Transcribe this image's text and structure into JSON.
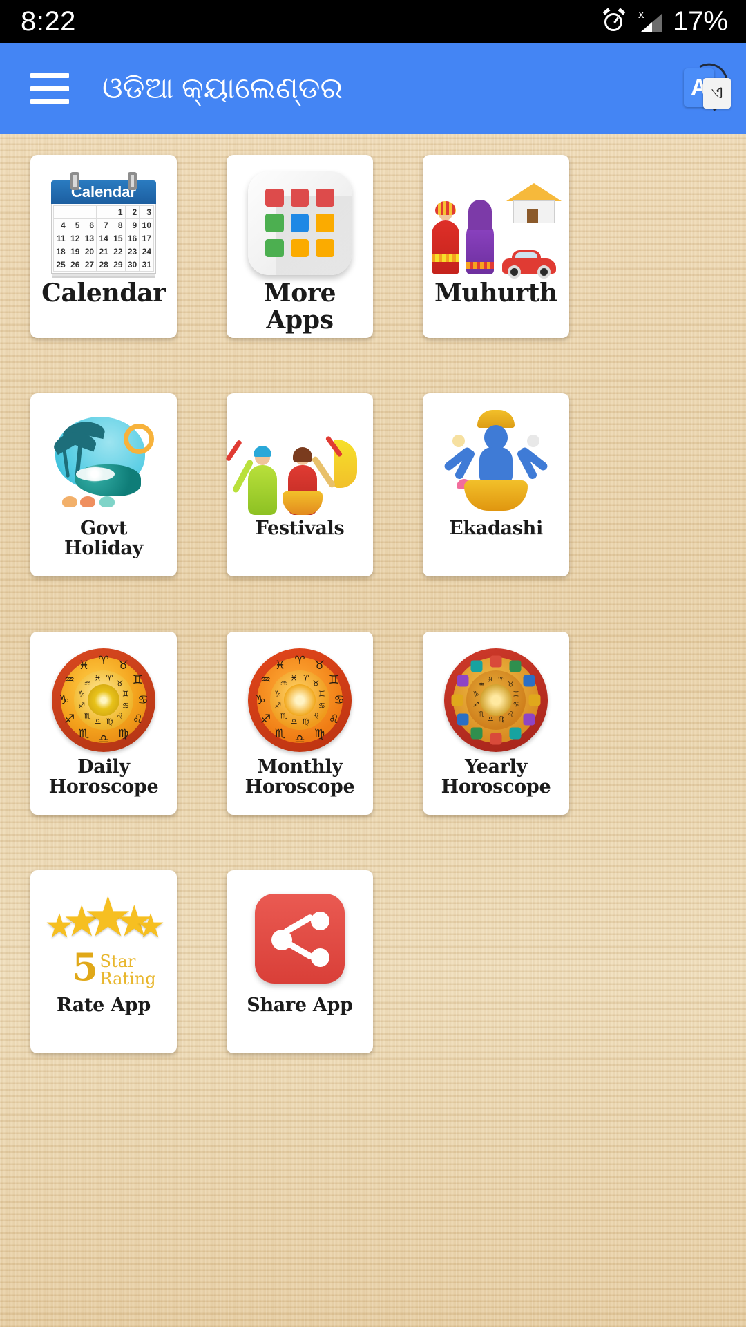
{
  "status_bar": {
    "time": "8:22",
    "battery": "17%",
    "alarm_icon": "alarm-clock-icon",
    "signal_icon": "signal-bars-icon",
    "signal_badge": "x"
  },
  "app_bar": {
    "menu_icon": "hamburger-menu-icon",
    "title": "ଓଡିଆ କ୍ୟାଲେଣ୍ଡର",
    "translate_icon": "translate-icon",
    "translate_source_letter": "A",
    "translate_target_letter": "ଏ",
    "background_color": "#4485f4"
  },
  "calendar_art": {
    "header": "Calendar",
    "weeks": [
      [
        "",
        "",
        "",
        "",
        "1",
        "2",
        "3"
      ],
      [
        "4",
        "5",
        "6",
        "7",
        "8",
        "9",
        "10"
      ],
      [
        "11",
        "12",
        "13",
        "14",
        "15",
        "16",
        "17"
      ],
      [
        "18",
        "19",
        "20",
        "21",
        "22",
        "23",
        "24"
      ],
      [
        "25",
        "26",
        "27",
        "28",
        "29",
        "30",
        "31"
      ]
    ]
  },
  "more_apps_art": {
    "swatches": [
      "#dd4b4b",
      "#dd4b4b",
      "#dd4b4b",
      "#4caf50",
      "#1e88e5",
      "#fbab00",
      "#4caf50",
      "#fbab00",
      "#fbab00"
    ]
  },
  "rate_art": {
    "number": "5",
    "word_top": "Star",
    "word_bottom": "Rating",
    "star_glyph": "★"
  },
  "zodiac_symbols": [
    "♈",
    "♉",
    "♊",
    "♋",
    "♌",
    "♍",
    "♎",
    "♏",
    "♐",
    "♑",
    "♒",
    "♓"
  ],
  "gem_colors": [
    "#d94a3a",
    "#2f8f4e",
    "#2b6fc4",
    "#e0a81c",
    "#8e44c4",
    "#17a3a0",
    "#d94a3a",
    "#2f8f4e",
    "#2b6fc4",
    "#e0a81c",
    "#8e44c4",
    "#17a3a0"
  ],
  "grid": {
    "rows": [
      [
        {
          "label": "Calendar",
          "label_lines": [
            "Calendar"
          ],
          "icon": "calendar-icon",
          "size": "big"
        },
        {
          "label": "More Apps",
          "label_lines": [
            "More Apps"
          ],
          "icon": "more-apps-grid-icon",
          "size": "big"
        },
        {
          "label": "Muhurth",
          "label_lines": [
            "Muhurth"
          ],
          "icon": "wedding-couple-icon",
          "size": "big"
        }
      ],
      [
        {
          "label": "Govt Holiday",
          "label_lines": [
            "Govt",
            "Holiday"
          ],
          "icon": "beach-holiday-icon",
          "size": "two"
        },
        {
          "label": "Festivals",
          "label_lines": [
            "Festivals"
          ],
          "icon": "folk-dancers-icon",
          "size": "mid"
        },
        {
          "label": "Ekadashi",
          "label_lines": [
            "Ekadashi"
          ],
          "icon": "vishnu-deity-icon",
          "size": "mid"
        }
      ],
      [
        {
          "label": "Daily Horoscope",
          "label_lines": [
            "Daily",
            "Horoscope"
          ],
          "icon": "zodiac-wheel-icon",
          "size": "two"
        },
        {
          "label": "Monthly Horoscope",
          "label_lines": [
            "Monthly",
            "Horoscope"
          ],
          "icon": "zodiac-wheel-icon",
          "size": "two"
        },
        {
          "label": "Yearly Horoscope",
          "label_lines": [
            "Yearly",
            "Horoscope"
          ],
          "icon": "zodiac-wheel-icon",
          "size": "two"
        }
      ],
      [
        {
          "label": "Rate App",
          "label_lines": [
            "Rate App"
          ],
          "icon": "five-star-rating-icon",
          "size": "mid"
        },
        {
          "label": "Share App",
          "label_lines": [
            "Share App"
          ],
          "icon": "share-network-icon",
          "size": "mid"
        }
      ]
    ]
  }
}
